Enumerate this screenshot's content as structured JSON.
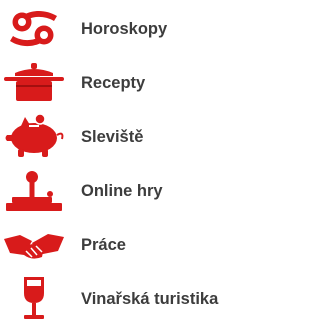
{
  "menu": {
    "items": [
      {
        "label": "Horoskopy",
        "icon": "cancer-zodiac-icon"
      },
      {
        "label": "Recepty",
        "icon": "cooking-pot-icon"
      },
      {
        "label": "Sleviště",
        "icon": "piggy-bank-icon"
      },
      {
        "label": "Online hry",
        "icon": "joystick-icon"
      },
      {
        "label": "Práce",
        "icon": "handshake-icon"
      },
      {
        "label": "Vinařská turistika",
        "icon": "wine-glass-icon"
      }
    ]
  },
  "colors": {
    "icon_red": "#d81b1b",
    "label_text": "#3d3d3d"
  }
}
